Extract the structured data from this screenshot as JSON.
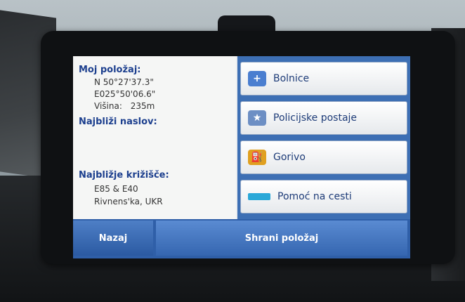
{
  "location": {
    "heading": "Moj položaj:",
    "latitude": "N 50°27'37.3\"",
    "longitude": "E025°50'06.6\"",
    "altitude_label": "Višina:",
    "altitude_value": "235m"
  },
  "nearest_address": {
    "heading": "Najbliži naslov:"
  },
  "nearest_intersection": {
    "heading": "Najbližje križišče:",
    "roads": "E85 & E40",
    "place": "Rivnens'ka, UKR"
  },
  "poi_buttons": [
    {
      "label": "Bolnice",
      "icon": "hospital-icon",
      "color": "#4a7ed0"
    },
    {
      "label": "Policijske postaje",
      "icon": "police-badge-icon",
      "color": "#6d8fc4"
    },
    {
      "label": "Gorivo",
      "icon": "fuel-icon",
      "color": "#e0a020"
    },
    {
      "label": "Pomoć na cesti",
      "icon": "roadside-assistance-icon",
      "color": "#2aa8d8"
    }
  ],
  "bottom_bar": {
    "back_label": "Nazaj",
    "save_label": "Shrani položaj"
  }
}
